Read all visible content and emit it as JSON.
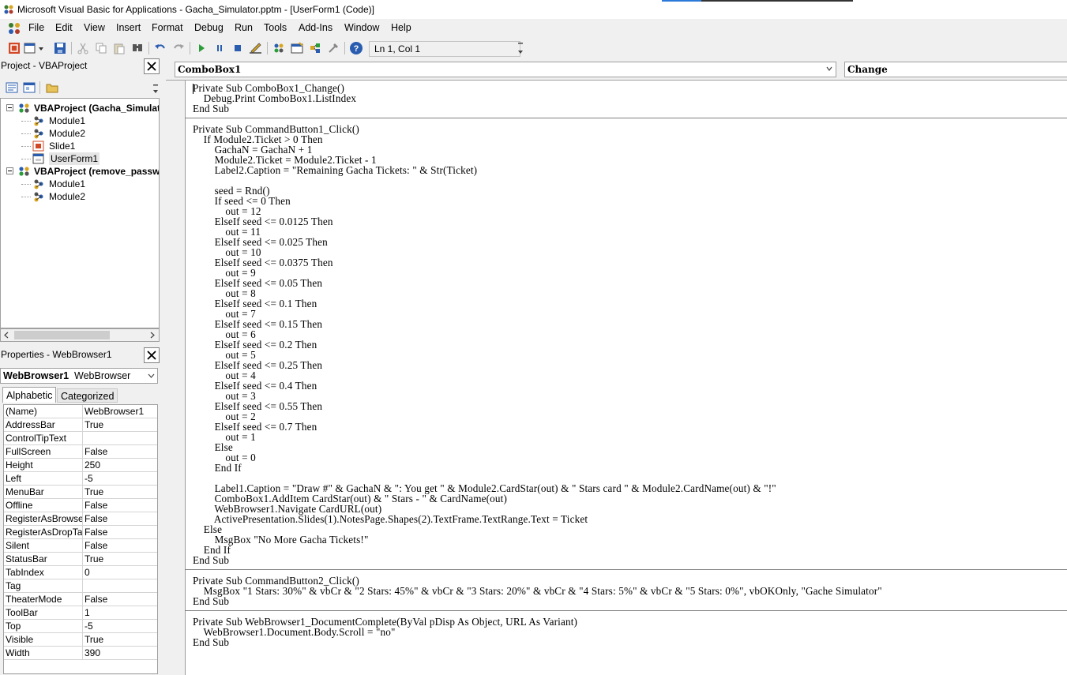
{
  "window": {
    "title": "Microsoft Visual Basic for Applications - Gacha_Simulator.pptm - [UserForm1 (Code)]"
  },
  "menu": [
    "File",
    "Edit",
    "View",
    "Insert",
    "Format",
    "Debug",
    "Run",
    "Tools",
    "Add-Ins",
    "Window",
    "Help"
  ],
  "toolbar": {
    "position": "Ln 1, Col 1",
    "buttons": [
      "view-powerpoint-icon",
      "insert-userform-icon",
      "save-icon",
      "cut-icon",
      "copy-icon",
      "paste-icon",
      "find-icon",
      "undo-icon",
      "redo-icon",
      "run-icon",
      "break-icon",
      "reset-icon",
      "design-mode-icon",
      "project-explorer-icon",
      "properties-window-icon",
      "object-browser-icon",
      "toolbox-icon",
      "help-icon"
    ]
  },
  "project": {
    "header": "Project - VBAProject",
    "tree": [
      {
        "label": "VBAProject (Gacha_Simulator.pptm)",
        "level": 0,
        "type": "project"
      },
      {
        "label": "Module1",
        "level": 1,
        "type": "module"
      },
      {
        "label": "Module2",
        "level": 1,
        "type": "module"
      },
      {
        "label": "Slide1",
        "level": 1,
        "type": "slide"
      },
      {
        "label": "UserForm1",
        "level": 1,
        "type": "form"
      },
      {
        "label": "VBAProject (remove_password.pptm)",
        "level": 0,
        "type": "project"
      },
      {
        "label": "Module1",
        "level": 1,
        "type": "module"
      },
      {
        "label": "Module2",
        "level": 1,
        "type": "module"
      }
    ]
  },
  "properties": {
    "header": "Properties - WebBrowser1",
    "object_name": "WebBrowser1",
    "object_type": "WebBrowser",
    "tabs": [
      "Alphabetic",
      "Categorized"
    ],
    "rows": [
      {
        "name": "(Name)",
        "value": "WebBrowser1"
      },
      {
        "name": "AddressBar",
        "value": "True"
      },
      {
        "name": "ControlTipText",
        "value": ""
      },
      {
        "name": "FullScreen",
        "value": "False"
      },
      {
        "name": "Height",
        "value": "250"
      },
      {
        "name": "Left",
        "value": "-5"
      },
      {
        "name": "MenuBar",
        "value": "True"
      },
      {
        "name": "Offline",
        "value": "False"
      },
      {
        "name": "RegisterAsBrowser",
        "value": "False"
      },
      {
        "name": "RegisterAsDropTarget",
        "value": "False"
      },
      {
        "name": "Silent",
        "value": "False"
      },
      {
        "name": "StatusBar",
        "value": "True"
      },
      {
        "name": "TabIndex",
        "value": "0"
      },
      {
        "name": "Tag",
        "value": ""
      },
      {
        "name": "TheaterMode",
        "value": "False"
      },
      {
        "name": "ToolBar",
        "value": "1"
      },
      {
        "name": "Top",
        "value": "-5"
      },
      {
        "name": "Visible",
        "value": "True"
      },
      {
        "name": "Width",
        "value": "390"
      }
    ]
  },
  "code_window": {
    "object_combo": "ComboBox1",
    "procedure_combo": "Change",
    "lines": [
      "Private Sub ComboBox1_Change()",
      "    Debug.Print ComboBox1.ListIndex",
      "End Sub",
      "",
      "Private Sub CommandButton1_Click()",
      "    If Module2.Ticket > 0 Then",
      "        GachaN = GachaN + 1",
      "        Module2.Ticket = Module2.Ticket - 1",
      "        Label2.Caption = \"Remaining Gacha Tickets: \" & Str(Ticket)",
      "",
      "        seed = Rnd()",
      "        If seed <= 0 Then",
      "            out = 12",
      "        ElseIf seed <= 0.0125 Then",
      "            out = 11",
      "        ElseIf seed <= 0.025 Then",
      "            out = 10",
      "        ElseIf seed <= 0.0375 Then",
      "            out = 9",
      "        ElseIf seed <= 0.05 Then",
      "            out = 8",
      "        ElseIf seed <= 0.1 Then",
      "            out = 7",
      "        ElseIf seed <= 0.15 Then",
      "            out = 6",
      "        ElseIf seed <= 0.2 Then",
      "            out = 5",
      "        ElseIf seed <= 0.25 Then",
      "            out = 4",
      "        ElseIf seed <= 0.4 Then",
      "            out = 3",
      "        ElseIf seed <= 0.55 Then",
      "            out = 2",
      "        ElseIf seed <= 0.7 Then",
      "            out = 1",
      "        Else",
      "            out = 0",
      "        End If",
      "",
      "        Label1.Caption = \"Draw #\" & GachaN & \": You get \" & Module2.CardStar(out) & \" Stars card \" & Module2.CardName(out) & \"!\"",
      "        ComboBox1.AddItem CardStar(out) & \" Stars - \" & CardName(out)",
      "        WebBrowser1.Navigate CardURL(out)",
      "        ActivePresentation.Slides(1).NotesPage.Shapes(2).TextFrame.TextRange.Text = Ticket",
      "    Else",
      "        MsgBox \"No More Gacha Tickets!\"",
      "    End If",
      "End Sub",
      "",
      "Private Sub CommandButton2_Click()",
      "    MsgBox \"1 Stars: 30%\" & vbCr & \"2 Stars: 45%\" & vbCr & \"3 Stars: 20%\" & vbCr & \"4 Stars: 5%\" & vbCr & \"5 Stars: 0%\", vbOKOnly, \"Gache Simulator\"",
      "End Sub",
      "",
      "Private Sub WebBrowser1_DocumentComplete(ByVal pDisp As Object, URL As Variant)",
      "    WebBrowser1.Document.Body.Scroll = \"no\"",
      "End Sub"
    ]
  }
}
